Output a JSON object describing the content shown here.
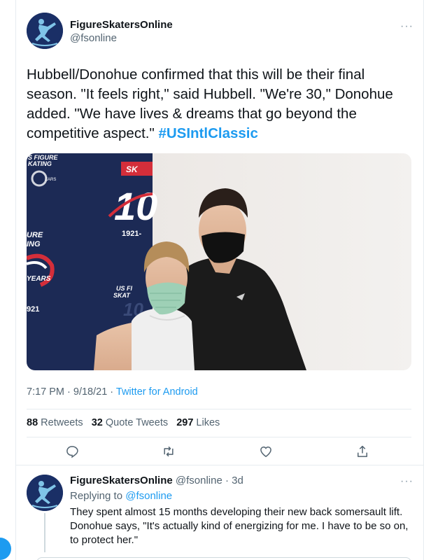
{
  "tweet": {
    "author_name": "FigureSkatersOnline",
    "author_handle": "@fsonline",
    "more": "···",
    "text_main": "Hubbell/Donohue confirmed that this will be their final season. \"It feels right,\" said Hubbell. \"We're 30,\" Donohue added. \"We have lives & dreams that go beyond the competitive aspect.\"",
    "hashtag": "#USIntlClassic",
    "time": "7:17 PM · 9/18/21 · ",
    "source": "Twitter for Android",
    "media": {
      "backdrop_usfs": "US FIGURE SKATING",
      "backdrop_years": "1921-",
      "backdrop_label_years": "YEARS",
      "backdrop_100": "10",
      "colors": {
        "backdrop": "#1c2a55",
        "wall": "#eeeae7",
        "accent_red": "#d42e3a"
      }
    }
  },
  "stats": {
    "retweets_count": "88",
    "retweets_label": "Retweets",
    "quotes_count": "32",
    "quotes_label": "Quote Tweets",
    "likes_count": "297",
    "likes_label": "Likes"
  },
  "actions": {
    "icons": [
      "reply-icon",
      "retweet-icon",
      "like-icon",
      "share-icon"
    ]
  },
  "reply": {
    "author_name": "FigureSkatersOnline",
    "handle_time": " @fsonline · 3d",
    "replying_prefix": "Replying to ",
    "replying_mention": "@fsonline",
    "text": "They spent almost 15 months developing their new back somersault lift. Donohue says, \"It's actually kind of energizing for me. I have to be so on, to protect her.\"",
    "more": "···"
  },
  "colors": {
    "accent": "#1d9bf0",
    "secondary_text": "#536471",
    "divider": "#e6ecf0"
  }
}
